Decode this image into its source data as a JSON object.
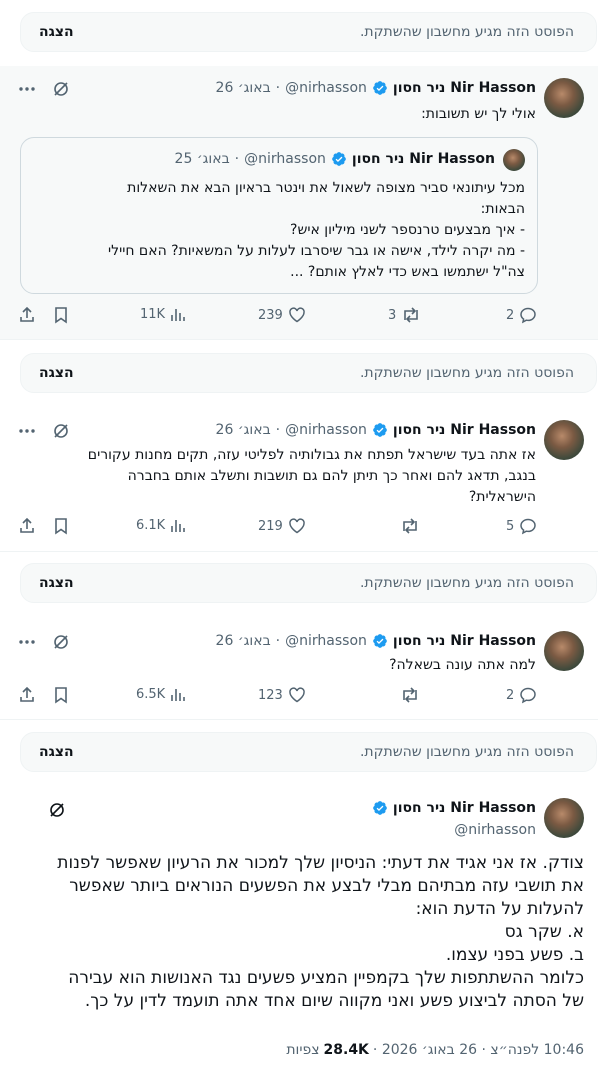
{
  "hidden_notice": {
    "message": "הפוסט הזה מגיע מחשבון שהשתקת.",
    "show_label": "הצגה"
  },
  "author": {
    "name": "ניר חסון Nir Hasson",
    "handle": "@nirhasson"
  },
  "tweets": [
    {
      "date": "26 באוג׳",
      "text": "אולי לך יש תשובות:",
      "quote": {
        "date": "25 באוג׳",
        "lines": [
          "מכל עיתונאי סביר מצופה לשאול את וינטר בראיון הבא את השאלות",
          "הבאות:",
          "- איך מבצעים טרנספר לשני מיליון איש?",
          "- מה יקרה לילד, אישה או גבר שיסרבו לעלות על המשאיות? האם חיילי",
          "צה\"ל ישתמשו באש כדי לאלץ אותם? ..."
        ]
      },
      "replies": "2",
      "reposts": "3",
      "likes": "239",
      "views": "11K"
    },
    {
      "date": "26 באוג׳",
      "lines": [
        "אז אתה בעד שישראל תפתח את גבולותיה לפליטי עזה, תקים מחנות עקורים",
        "בנגב, תדאג להם ואחר כך תיתן להם גם תושבות ותשלב אותם בחברה",
        "הישראלית?"
      ],
      "replies": "5",
      "reposts": "",
      "likes": "219",
      "views": "6.1K"
    },
    {
      "date": "26 באוג׳",
      "text": "למה אתה עונה בשאלה?",
      "replies": "2",
      "reposts": "",
      "likes": "123",
      "views": "6.5K"
    }
  ],
  "main_tweet": {
    "lines": [
      "צודק. אז אני אגיד את דעתי: הניסיון שלך למכור את הרעיון שאפשר לפנות",
      "את תושבי עזה מבתיהם מבלי לבצע את הפשעים הנוראים ביותר שאפשר",
      "להעלות על הדעת הוא:",
      "א. שקר גס",
      "ב. פשע בפני עצמו.",
      "כלומר ההשתתפות שלך בקמפיין המציע פשעים נגד האנושות הוא עבירה",
      "של הסתה לביצוע פשע ואני מקווה שיום אחד אתה תועמד לדין על כך."
    ],
    "time_date": "10:46 לפנה״צ · 26 באוג׳ 2026 ·",
    "views_count": "28.4K",
    "views_label": "צפיות"
  },
  "colors": {
    "accent": "#1d9bf0",
    "muted": "#536471",
    "text": "#0f1419",
    "hidden_bg": "#f7f9f9"
  }
}
